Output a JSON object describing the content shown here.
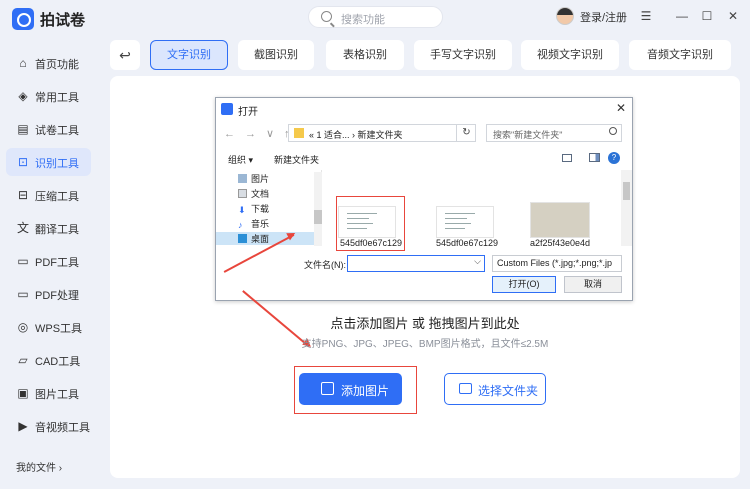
{
  "app": {
    "title": "拍试卷",
    "search_placeholder": "搜索功能",
    "login_label": "登录/注册",
    "window_controls": [
      "☰",
      "—",
      "☐",
      "✕"
    ]
  },
  "sidebar": {
    "items": [
      {
        "icon": "home-icon",
        "glyph": "⌂",
        "label": "首页功能"
      },
      {
        "icon": "layers-icon",
        "glyph": "◈",
        "label": "常用工具"
      },
      {
        "icon": "paper-icon",
        "glyph": "▤",
        "label": "试卷工具"
      },
      {
        "icon": "scan-icon",
        "glyph": "⊡",
        "label": "识别工具",
        "active": true
      },
      {
        "icon": "compress-icon",
        "glyph": "⊟",
        "label": "压缩工具"
      },
      {
        "icon": "translate-icon",
        "glyph": "文",
        "label": "翻译工具"
      },
      {
        "icon": "pdf-icon",
        "glyph": "▭",
        "label": "PDF工具"
      },
      {
        "icon": "pdf-process-icon",
        "glyph": "▭",
        "label": "PDF处理"
      },
      {
        "icon": "wps-icon",
        "glyph": "◎",
        "label": "WPS工具"
      },
      {
        "icon": "cad-icon",
        "glyph": "▱",
        "label": "CAD工具"
      },
      {
        "icon": "image-icon",
        "glyph": "▣",
        "label": "图片工具"
      },
      {
        "icon": "video-icon",
        "glyph": "▶",
        "label": "音视频工具"
      }
    ],
    "my_files": "我的文件 ›"
  },
  "tabs": [
    {
      "label": "文字识别",
      "active": true
    },
    {
      "label": "截图识别"
    },
    {
      "label": "表格识别"
    },
    {
      "label": "手写文字识别"
    },
    {
      "label": "视频文字识别"
    },
    {
      "label": "音频文字识别"
    }
  ],
  "dialog": {
    "title": "打开",
    "path": "« 1 适合... › 新建文件夹",
    "search_placeholder": "搜索\"新建文件夹\"",
    "organize": "组织 ▾",
    "new_folder": "新建文件夹",
    "tree": [
      "图片",
      "文档",
      "下载",
      "音乐",
      "桌面"
    ],
    "files": [
      "545df0e67c129",
      "545df0e67c129",
      "a2f25f43e0e4d"
    ],
    "filename_label": "文件名(N):",
    "filename_value": "",
    "filter": "Custom Files (*.jpg;*.png;*.jp",
    "open_button": "打开(O)",
    "cancel_button": "取消"
  },
  "dropzone": {
    "main_hint": "点击添加图片 或 拖拽图片到此处",
    "sub_hint": "支持PNG、JPG、JPEG、BMP图片格式，且文件≤2.5M",
    "add_button": "添加图片",
    "folder_button": "选择文件夹"
  },
  "colors": {
    "accent": "#2f6ef5",
    "highlight": "#e8463c"
  }
}
